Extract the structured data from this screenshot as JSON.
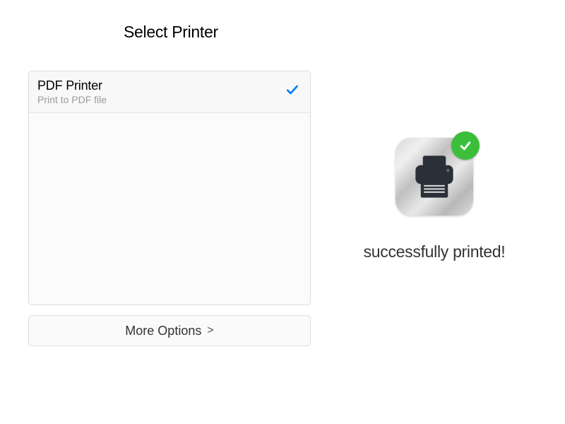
{
  "title": "Select Printer",
  "printers": [
    {
      "name": "PDF Printer",
      "description": "Print to PDF file",
      "selected": true
    }
  ],
  "more_options_label": "More Options",
  "status": {
    "message": "successfully printed!",
    "badge_color": "#3bbf3b",
    "icon": "printer-icon"
  }
}
